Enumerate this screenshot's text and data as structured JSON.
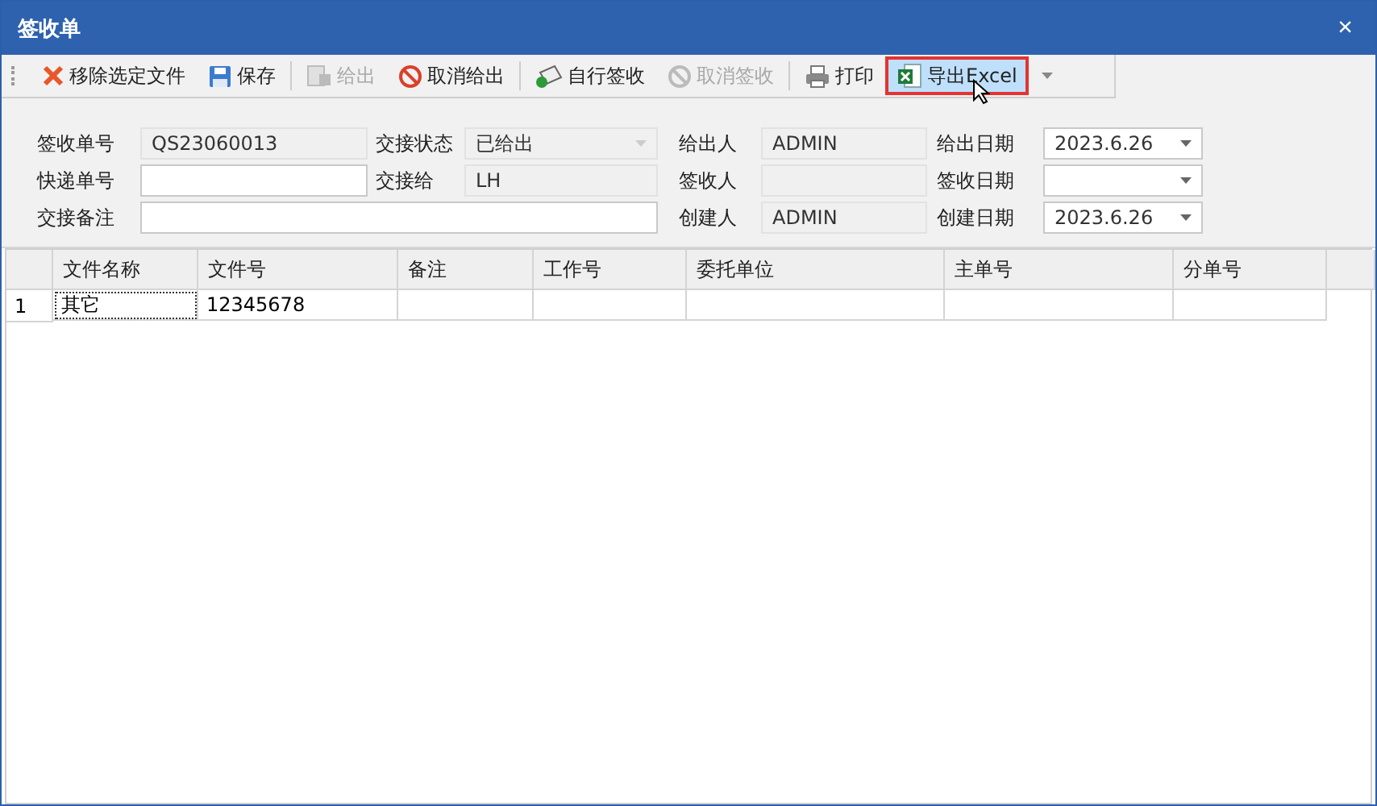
{
  "window": {
    "title": "签收单",
    "close": "×"
  },
  "toolbar": [
    {
      "kind": "remove",
      "label": "移除选定文件",
      "disabled": false,
      "highlighted": false
    },
    {
      "kind": "save",
      "label": "保存",
      "disabled": false,
      "highlighted": false
    },
    {
      "kind": "give",
      "label": "给出",
      "disabled": true,
      "highlighted": false
    },
    {
      "kind": "cancel",
      "label": "取消给出",
      "disabled": false,
      "highlighted": false
    },
    {
      "kind": "sign",
      "label": "自行签收",
      "disabled": false,
      "highlighted": false
    },
    {
      "kind": "cancel",
      "label": "取消签收",
      "disabled": true,
      "highlighted": false
    },
    {
      "kind": "print",
      "label": "打印",
      "disabled": false,
      "highlighted": false
    },
    {
      "kind": "excel",
      "label": "导出Excel",
      "disabled": false,
      "highlighted": true
    }
  ],
  "form": [
    [
      {
        "label": "签收单号",
        "value": "QS23060013",
        "kind": "text",
        "readonly": true
      },
      {
        "label": "交接状态",
        "value": "已给出",
        "kind": "combo",
        "readonly": true
      },
      {
        "label": "给出人",
        "value": "ADMIN",
        "kind": "text",
        "readonly": true
      },
      {
        "label": "给出日期",
        "value": "2023.6.26",
        "kind": "combo",
        "readonly": false
      }
    ],
    [
      {
        "label": "快递单号",
        "kind": "text",
        "readonly": false
      },
      {
        "label": "交接给",
        "value": "LH",
        "kind": "text",
        "readonly": true
      },
      {
        "label": "签收人",
        "kind": "text",
        "readonly": true
      },
      {
        "label": "签收日期",
        "kind": "combo",
        "readonly": false
      }
    ],
    [
      {
        "label": "交接备注",
        "kind": "wide",
        "readonly": false
      },
      {
        "label": "创建人",
        "value": "ADMIN",
        "kind": "text",
        "readonly": true
      },
      {
        "label": "创建日期",
        "value": "2023.6.26",
        "kind": "combo",
        "readonly": false
      }
    ]
  ],
  "grid": {
    "columns": [
      "文件名称",
      "文件号",
      "备注",
      "工作号",
      "委托单位",
      "主单号",
      "分单号"
    ],
    "rows": [
      {
        "number": "1",
        "cells": [
          {
            "text": "其它",
            "focused": true
          },
          {
            "text": "12345678",
            "focused": false
          },
          {
            "focused": false
          },
          {
            "focused": false
          },
          {
            "focused": false
          },
          {
            "focused": false
          },
          {
            "focused": false
          }
        ]
      }
    ]
  }
}
